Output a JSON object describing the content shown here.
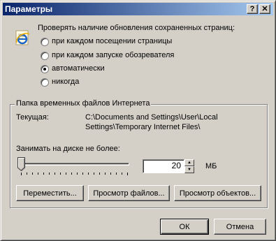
{
  "window": {
    "title": "Параметры",
    "help_label": "?",
    "close_label": "✕"
  },
  "update_check": {
    "prompt": "Проверять наличие обновления сохраненных страниц:",
    "options": [
      {
        "label": "при каждом посещении страницы",
        "checked": false
      },
      {
        "label": "при каждом запуске обозревателя",
        "checked": false
      },
      {
        "label": "автоматически",
        "checked": true
      },
      {
        "label": "никогда",
        "checked": false
      }
    ]
  },
  "temp_folder": {
    "group_label": "Папка временных файлов Интернета",
    "current_label": "Текущая:",
    "path_line1": "C:\\Documents and Settings\\User\\Local",
    "path_line2": "Settings\\Temporary Internet Files\\",
    "disk_label": "Занимать на диске не более:",
    "size_value": "20",
    "size_unit": "МБ",
    "slider_fraction": 0.0
  },
  "buttons": {
    "move": "Переместить...",
    "view_files": "Просмотр файлов...",
    "view_objects": "Просмотр объектов...",
    "ok": "ОК",
    "cancel": "Отмена"
  },
  "icons": {
    "app": "internet-explorer-icon",
    "slider_thumb": "slider-thumb-icon",
    "spin_up": "spin-up-arrow-icon",
    "spin_down": "spin-down-arrow-icon"
  }
}
